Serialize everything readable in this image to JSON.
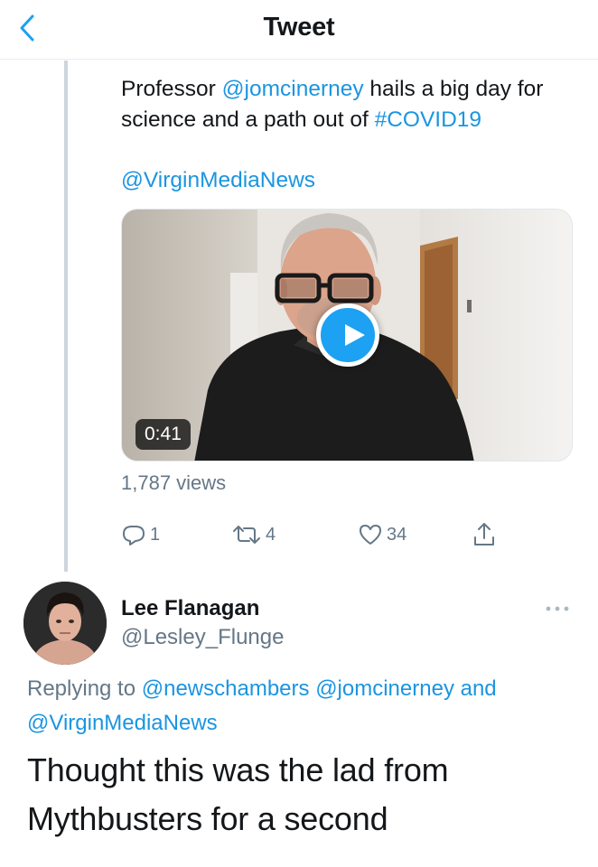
{
  "header": {
    "title": "Tweet",
    "back_icon": "chevron-left-icon",
    "accent_color": "#1da1f2"
  },
  "tweet": {
    "text_prefix": "Professor ",
    "mention_1": "@jomcinerney",
    "text_middle": " hails a big day for science and a path out of ",
    "hashtag": "#COVID19",
    "mention_2": "@VirginMediaNews",
    "video": {
      "duration": "0:41",
      "play_icon": "play-icon"
    },
    "views": "1,787 views",
    "actions": {
      "replies": "1",
      "retweets": "4",
      "likes": "34"
    }
  },
  "reply": {
    "name": "Lee Flanagan",
    "handle": "@Lesley_Flunge",
    "replying_label": "Replying to ",
    "replying_user_1": "@newschambers",
    "replying_user_2": "@jomcinerney",
    "replying_and": " and ",
    "replying_user_3": "@VirginMediaNews",
    "text": "Thought this was the lad from Mythbusters for a second"
  }
}
